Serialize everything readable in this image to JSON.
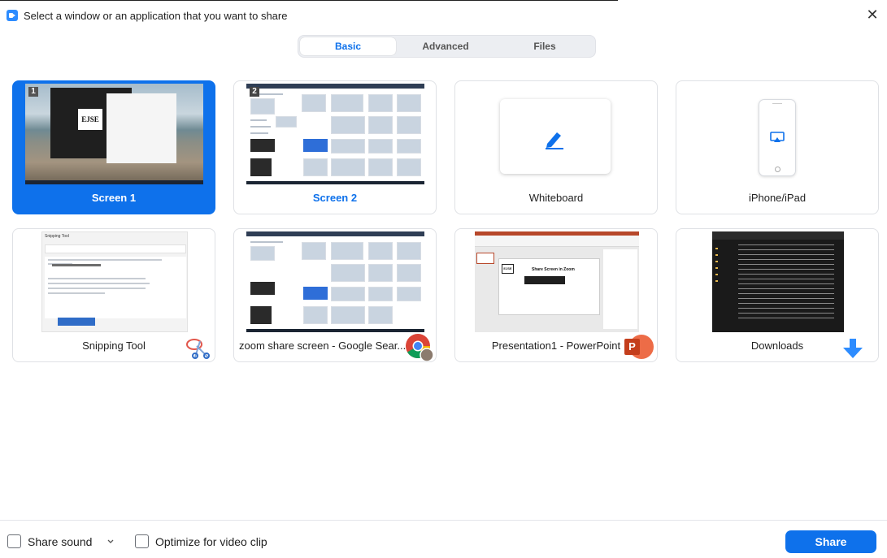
{
  "window": {
    "title": "Select a window or an application that you want to share",
    "close_glyph": "✕"
  },
  "tabs": [
    {
      "label": "Basic",
      "selected": true
    },
    {
      "label": "Advanced",
      "selected": false
    },
    {
      "label": "Files",
      "selected": false
    }
  ],
  "sources": [
    {
      "label": "Screen 1",
      "selected": true,
      "screen_number": "1"
    },
    {
      "label": "Screen 2",
      "selected": false,
      "screen_number": "2"
    },
    {
      "label": "Whiteboard",
      "selected": false,
      "icon": "pen-icon"
    },
    {
      "label": "iPhone/iPad",
      "selected": false,
      "icon": "airplay-icon"
    },
    {
      "label": "Snipping Tool",
      "selected": false,
      "icon": "snipping-tool-icon"
    },
    {
      "label": "zoom share screen - Google Sear...",
      "selected": false,
      "icon": "chrome-icon"
    },
    {
      "label": "Presentation1 - PowerPoint",
      "selected": false,
      "icon": "powerpoint-icon"
    },
    {
      "label": "Downloads",
      "selected": false,
      "icon": "download-arrow-icon"
    }
  ],
  "thumbnails": {
    "screen1_logo": "EJSE",
    "snipping_title": "Snipping Tool",
    "ppt_slide_title": "Share Screen in Zoom",
    "ppt_logo": "EJSE",
    "ppt_badge_letter": "P"
  },
  "footer": {
    "share_sound_label": "Share sound",
    "share_sound_checked": false,
    "optimize_label": "Optimize for video clip",
    "optimize_checked": false,
    "share_button_label": "Share"
  },
  "colors": {
    "accent": "#0e71eb",
    "tab_bg": "#eceef2",
    "card_border": "#dfe1e5"
  }
}
